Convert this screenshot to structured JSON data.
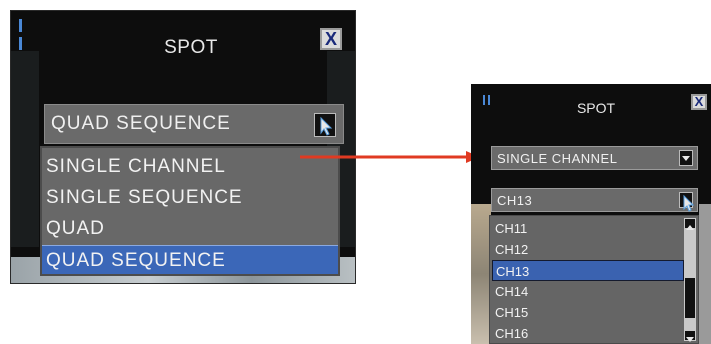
{
  "left_dialog": {
    "title": "SPOT",
    "close_label": "X",
    "mode_select": {
      "value": "QUAD SEQUENCE"
    },
    "mode_options": [
      {
        "label": "SINGLE CHANNEL",
        "selected": false
      },
      {
        "label": "SINGLE SEQUENCE",
        "selected": false
      },
      {
        "label": "QUAD",
        "selected": false
      },
      {
        "label": "QUAD SEQUENCE",
        "selected": true
      }
    ]
  },
  "right_dialog": {
    "title": "SPOT",
    "close_label": "X",
    "mode_select": {
      "value": "SINGLE CHANNEL"
    },
    "channel_select": {
      "value": "CH13"
    },
    "channel_options": [
      {
        "label": "CH11",
        "selected": false
      },
      {
        "label": "CH12",
        "selected": false
      },
      {
        "label": "CH13",
        "selected": true
      },
      {
        "label": "CH14",
        "selected": false
      },
      {
        "label": "CH15",
        "selected": false
      },
      {
        "label": "CH16",
        "selected": false
      }
    ]
  },
  "colors": {
    "highlight": "#3b67b8",
    "connector_arrow": "#e03a22",
    "panel_bg": "#0d0d0d",
    "select_bg": "#6a6a6a"
  },
  "icons": [
    "grip-icon",
    "close-icon",
    "dropdown-arrow-icon",
    "mouse-pointer-icon",
    "scroll-up-icon",
    "scroll-down-icon"
  ]
}
